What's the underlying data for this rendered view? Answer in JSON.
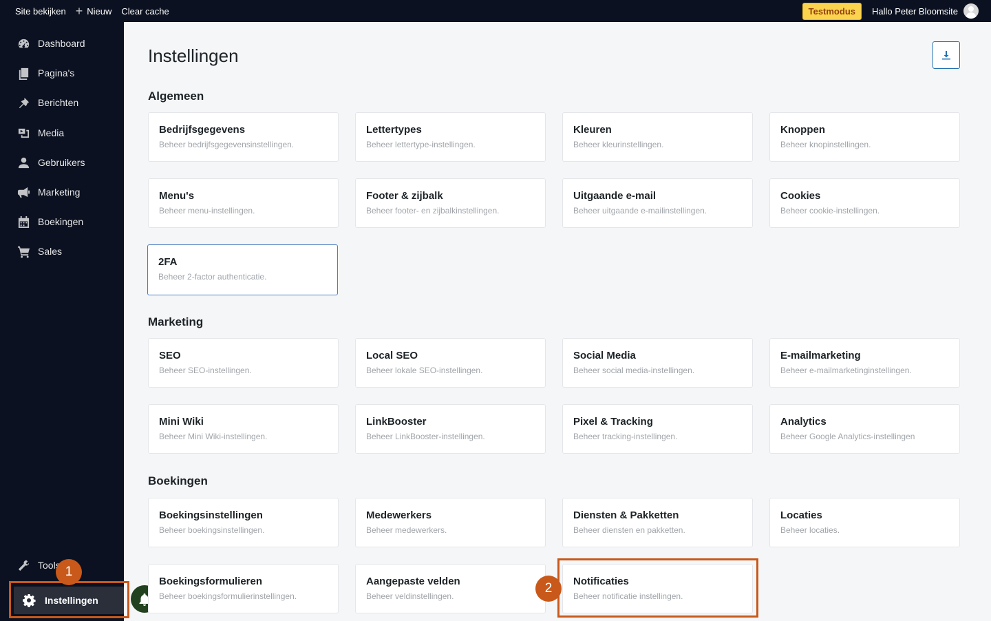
{
  "topbar": {
    "view_site": "Site bekijken",
    "new": "Nieuw",
    "clear_cache": "Clear cache",
    "test_badge": "Testmodus",
    "greeting": "Hallo Peter Bloomsite"
  },
  "sidebar": {
    "items": [
      {
        "label": "Dashboard",
        "icon": "dashboard-icon"
      },
      {
        "label": "Pagina's",
        "icon": "pages-icon"
      },
      {
        "label": "Berichten",
        "icon": "pin-icon"
      },
      {
        "label": "Media",
        "icon": "media-icon"
      },
      {
        "label": "Gebruikers",
        "icon": "user-icon"
      },
      {
        "label": "Marketing",
        "icon": "megaphone-icon"
      },
      {
        "label": "Boekingen",
        "icon": "calendar-icon"
      },
      {
        "label": "Sales",
        "icon": "cart-icon"
      }
    ],
    "tools_label": "Tools",
    "settings_label": "Instellingen"
  },
  "annotations": {
    "marker1": "1",
    "marker2": "2",
    "highlight_color": "#c8591a"
  },
  "main": {
    "title": "Instellingen",
    "sections": [
      {
        "title": "Algemeen",
        "cards": [
          {
            "title": "Bedrijfsgegevens",
            "desc": "Beheer bedrijfsgegevensinstellingen."
          },
          {
            "title": "Lettertypes",
            "desc": "Beheer lettertype-instellingen."
          },
          {
            "title": "Kleuren",
            "desc": "Beheer kleurinstellingen."
          },
          {
            "title": "Knoppen",
            "desc": "Beheer knopinstellingen."
          },
          {
            "title": "Menu's",
            "desc": "Beheer menu-instellingen."
          },
          {
            "title": "Footer & zijbalk",
            "desc": "Beheer footer- en zijbalkinstellingen."
          },
          {
            "title": "Uitgaande e-mail",
            "desc": "Beheer uitgaande e-mailinstellingen."
          },
          {
            "title": "Cookies",
            "desc": "Beheer cookie-instellingen."
          },
          {
            "title": "2FA",
            "desc": "Beheer 2-factor authenticatie."
          }
        ]
      },
      {
        "title": "Marketing",
        "cards": [
          {
            "title": "SEO",
            "desc": "Beheer SEO-instellingen."
          },
          {
            "title": "Local SEO",
            "desc": "Beheer lokale SEO-instellingen."
          },
          {
            "title": "Social Media",
            "desc": "Beheer social media-instellingen."
          },
          {
            "title": "E-mailmarketing",
            "desc": "Beheer e-mailmarketinginstellingen."
          },
          {
            "title": "Mini Wiki",
            "desc": "Beheer Mini Wiki-instellingen."
          },
          {
            "title": "LinkBooster",
            "desc": "Beheer LinkBooster-instellingen."
          },
          {
            "title": "Pixel & Tracking",
            "desc": "Beheer tracking-instellingen."
          },
          {
            "title": "Analytics",
            "desc": "Beheer Google Analytics-instellingen"
          }
        ]
      },
      {
        "title": "Boekingen",
        "cards": [
          {
            "title": "Boekingsinstellingen",
            "desc": "Beheer boekingsinstellingen."
          },
          {
            "title": "Medewerkers",
            "desc": "Beheer medewerkers."
          },
          {
            "title": "Diensten & Pakketten",
            "desc": "Beheer diensten en pakketten."
          },
          {
            "title": "Locaties",
            "desc": "Beheer locaties."
          },
          {
            "title": "Boekingsformulieren",
            "desc": "Beheer boekingsformulierinstellingen."
          },
          {
            "title": "Aangepaste velden",
            "desc": "Beheer veldinstellingen."
          },
          {
            "title": "Notificaties",
            "desc": "Beheer notificatie instellingen."
          }
        ]
      }
    ]
  }
}
